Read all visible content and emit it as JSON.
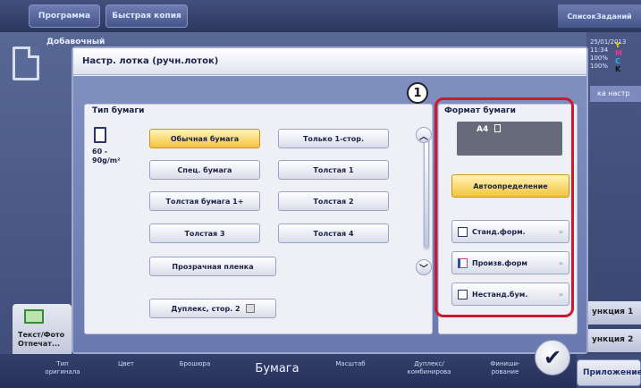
{
  "background": {
    "top_tabs": [
      "Программа",
      "Быстрая копия"
    ],
    "right_tab": "СписокЗаданий",
    "add_label": "Добавочный",
    "datetime": [
      "25/01/2013",
      "11:34",
      "100%",
      "100%"
    ],
    "toner": [
      "Y",
      "M",
      "C",
      "K"
    ],
    "settings_label": "ка настр",
    "func_1": "ункция 1",
    "func_2": "ункция 2",
    "app_button": "Приложение",
    "left_tile_text": [
      "Текст/Фото",
      "Отпечат..."
    ],
    "bottom_tabs": [
      "Тип\nоригинала",
      "Цвет",
      "Брошюра",
      "Бумага",
      "Масштаб",
      "Дуплекс/\nкомбинирова",
      "Финиши-\nрование"
    ]
  },
  "dialog": {
    "title": "Настр. лотка (ручн.лоток)",
    "paper_type": {
      "title": "Тип бумаги",
      "weight": "60 -\n90g/m²",
      "buttons": [
        "Обычная бумага",
        "Только 1-стор.",
        "Спец. бумага",
        "Толстая 1",
        "Толстая бумага 1+",
        "Толстая 2",
        "Толстая 3",
        "Толстая 4",
        "Прозрачная пленка",
        "Дуплекс, стор. 2"
      ],
      "selected": "Обычная бумага"
    },
    "paper_size": {
      "title": "Формат бумаги",
      "current": "A4",
      "auto_detect": "Автоопределение",
      "std_format": "Станд.форм.",
      "custom_format": "Произв.форм",
      "nonstd_paper": "Нестанд.бум."
    },
    "callout_number": "1"
  },
  "colors": {
    "selected": "#f3c43a",
    "highlight": "#d4162b",
    "dialog_body": "#7587b8"
  }
}
